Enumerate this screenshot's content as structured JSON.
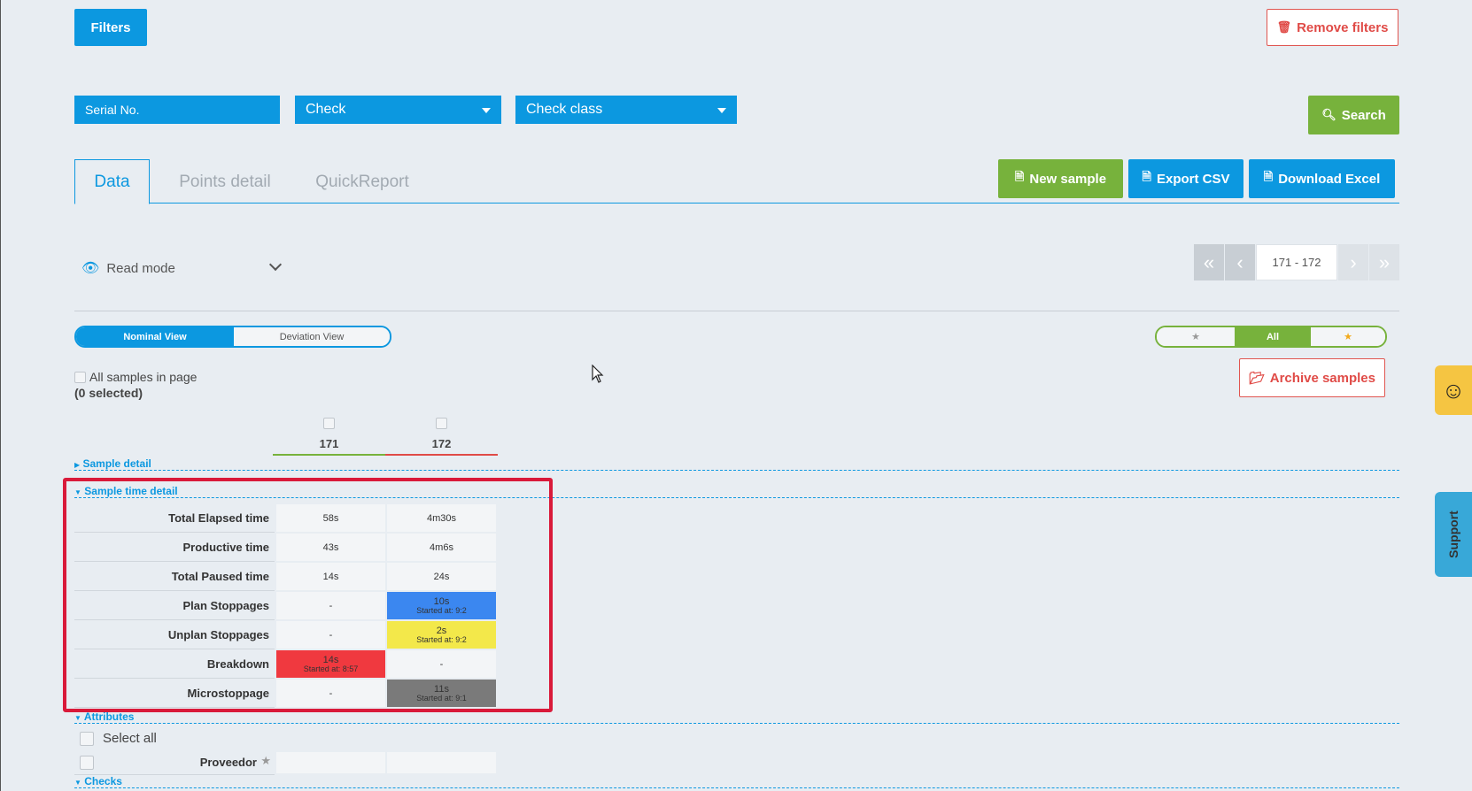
{
  "header": {
    "filters_label": "Filters",
    "remove_filters_label": "Remove filters",
    "search_label": "Search"
  },
  "filters": {
    "serial_placeholder": "Serial No.",
    "check_value": "Check",
    "check_class_value": "Check class"
  },
  "tabs": [
    {
      "label": "Data"
    },
    {
      "label": "Points detail"
    },
    {
      "label": "QuickReport"
    }
  ],
  "actions": {
    "new_sample": "New sample",
    "export_csv": "Export CSV",
    "download_excel": "Download Excel"
  },
  "mode": {
    "label": "Read mode"
  },
  "pager": {
    "range": "171 - 172"
  },
  "view_toggle": {
    "nominal": "Nominal View",
    "deviation": "Deviation View"
  },
  "star_filter": {
    "all": "All"
  },
  "selection": {
    "all_in_page": "All samples in page",
    "selected_count": "(0 selected)"
  },
  "archive_label": "Archive samples",
  "columns": [
    {
      "id": "171",
      "color": "#77b23c"
    },
    {
      "id": "172",
      "color": "#e04b47"
    }
  ],
  "sections": {
    "sample_detail": "Sample detail",
    "sample_time_detail": "Sample time detail",
    "attributes": "Attributes",
    "checks": "Checks"
  },
  "time_rows": [
    {
      "label": "Total Elapsed time",
      "values": [
        {
          "main": "58s",
          "sub": ""
        },
        {
          "main": "4m30s",
          "sub": ""
        }
      ]
    },
    {
      "label": "Productive time",
      "values": [
        {
          "main": "43s",
          "sub": ""
        },
        {
          "main": "4m6s",
          "sub": ""
        }
      ]
    },
    {
      "label": "Total Paused time",
      "values": [
        {
          "main": "14s",
          "sub": ""
        },
        {
          "main": "24s",
          "sub": ""
        }
      ]
    },
    {
      "label": "Plan Stoppages",
      "values": [
        {
          "main": "-",
          "sub": ""
        },
        {
          "main": "10s",
          "sub": "Started at: 9:2",
          "color": "#3b87f0"
        }
      ]
    },
    {
      "label": "Unplan Stoppages",
      "values": [
        {
          "main": "-",
          "sub": ""
        },
        {
          "main": "2s",
          "sub": "Started at: 9:2",
          "color": "#f3e84a"
        }
      ]
    },
    {
      "label": "Breakdown",
      "values": [
        {
          "main": "14s",
          "sub": "Started at: 8:57",
          "color": "#f0393f"
        },
        {
          "main": "-",
          "sub": ""
        }
      ]
    },
    {
      "label": "Microstoppage",
      "values": [
        {
          "main": "-",
          "sub": ""
        },
        {
          "main": "11s",
          "sub": "Started at: 9:1",
          "color": "#7a7a7a"
        }
      ]
    }
  ],
  "attributes": {
    "select_all": "Select all",
    "proveedor": "Proveedor"
  },
  "support_label": "Support"
}
